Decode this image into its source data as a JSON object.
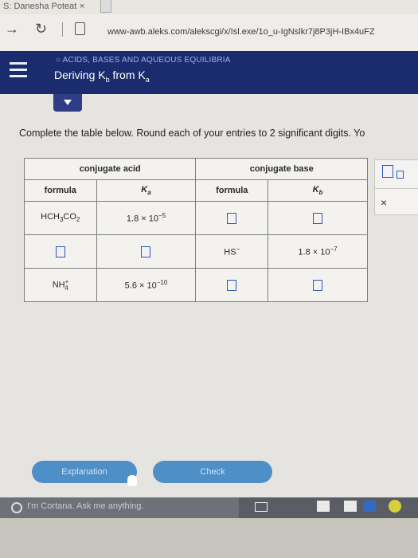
{
  "browser": {
    "tab_title": "S: Danesha Poteat",
    "tab_close": "×",
    "url": "www-awb.aleks.com/alekscgi/x/Isl.exe/1o_u-IgNslkr7j8P3jH-IBx4uFZ",
    "back_icon": "→",
    "reload_icon": "↻",
    "page_icon": "page-icon"
  },
  "aleks": {
    "topic": "○ ACIDS, BASES AND AQUEOUS EQUILIBRIA",
    "subtopic": "Deriving K",
    "subtopic_sub1": "b",
    "subtopic_mid": " from K",
    "subtopic_sub2": "a"
  },
  "problem": {
    "instruction": "Complete the table below. Round each of your entries to 2 significant digits. Yo",
    "table": {
      "group_headers": [
        "conjugate acid",
        "conjugate base"
      ],
      "col_headers": [
        "formula",
        "K",
        "formula",
        "K"
      ],
      "col_subs": [
        "",
        "a",
        "",
        "b"
      ],
      "rows": [
        {
          "acid_formula_parts": [
            "HCH",
            "3",
            "CO",
            "2"
          ],
          "ka_mantissa": "1.8",
          "ka_exp": "−5",
          "base_formula": "",
          "kb": ""
        },
        {
          "acid_formula": "",
          "ka": "",
          "base_formula": "HS",
          "base_charge": "−",
          "kb_mantissa": "1.8",
          "kb_exp": "−7"
        },
        {
          "acid_formula_parts": [
            "NH",
            "+",
            "4"
          ],
          "ka_mantissa": "5.6",
          "ka_exp": "−10",
          "base_formula": "",
          "kb": ""
        }
      ],
      "times_ten": "× 10"
    }
  },
  "buttons": {
    "explanation": "Explanation",
    "check": "Check"
  },
  "side_tools": {
    "close": "×"
  },
  "taskbar": {
    "cortana_placeholder": "I'm Cortana. Ask me anything."
  }
}
